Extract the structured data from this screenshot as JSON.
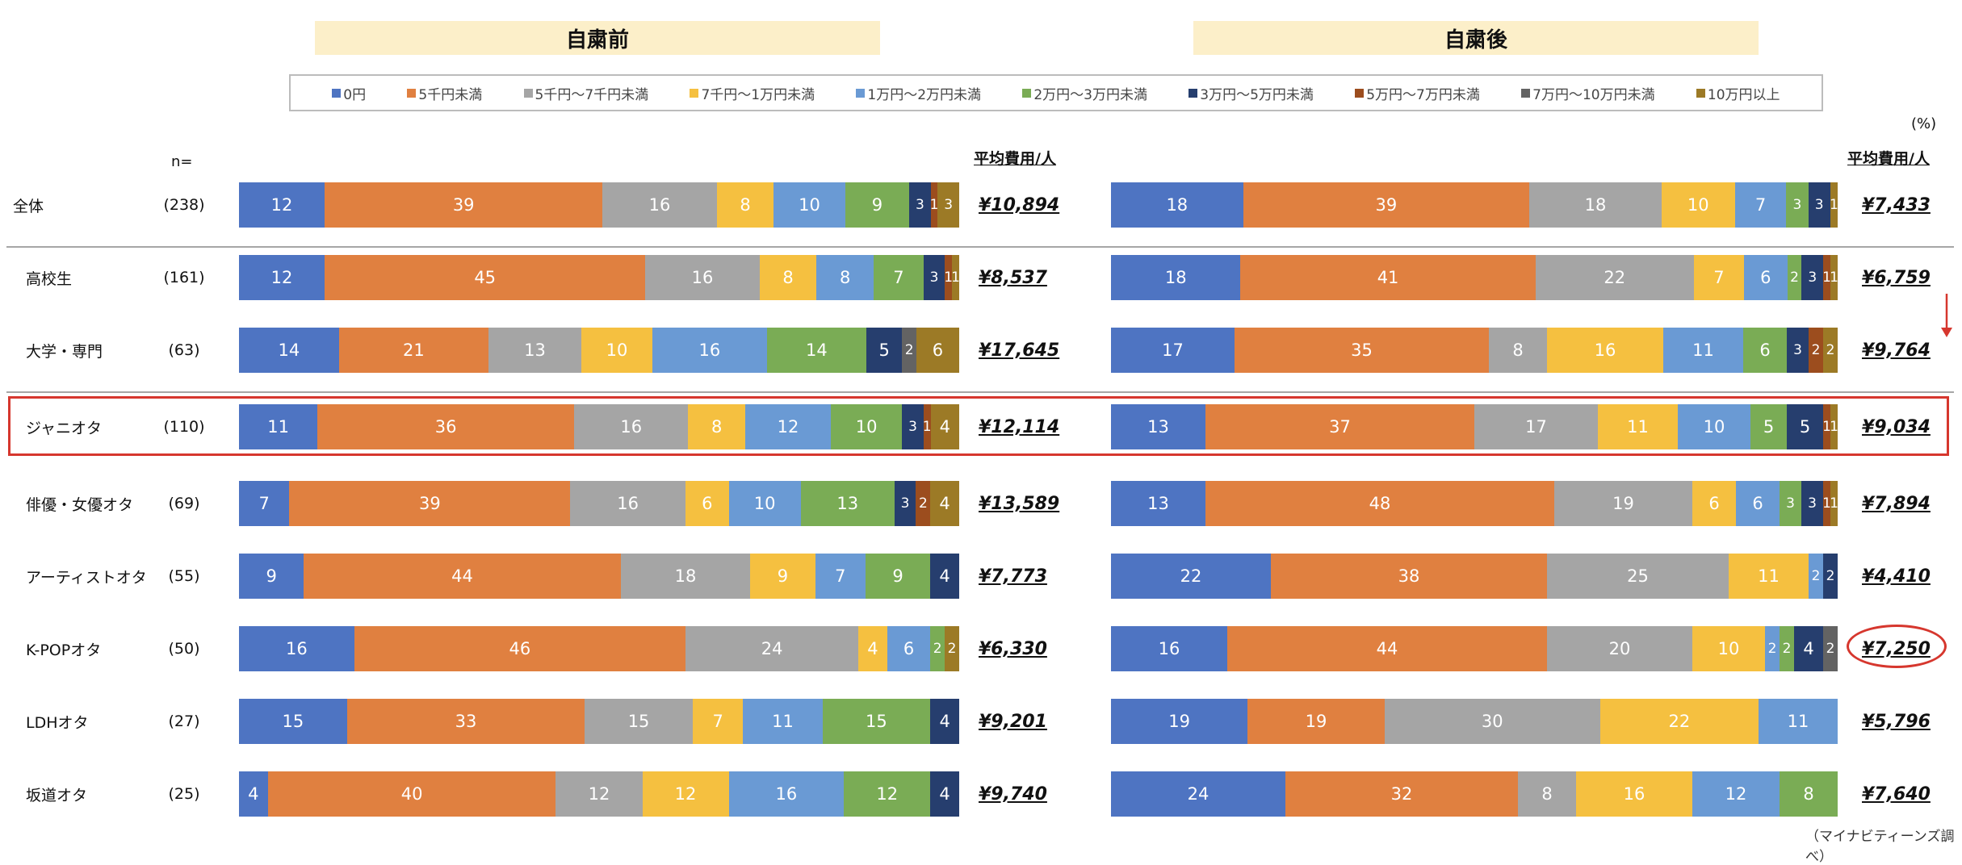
{
  "chart_data": {
    "type": "bar",
    "orientation": "horizontal",
    "stacked": true,
    "normalized": true,
    "panels": [
      {
        "name": "自粛前",
        "avg_header": "平均費用/人"
      },
      {
        "name": "自粛後",
        "avg_header": "平均費用/人"
      }
    ],
    "n_header": "n=",
    "unit": "(%)",
    "source": "（マイナビティーンズ調べ）",
    "legend": [
      "0円",
      "5千円未満",
      "5千円〜7千円未満",
      "7千円〜1万円未満",
      "1万円〜2万円未満",
      "2万円〜3万円未満",
      "3万円〜5万円未満",
      "5万円〜7万円未満",
      "7万円〜10万円未満",
      "10万円以上"
    ],
    "colors": [
      "#4e74c2",
      "#e08040",
      "#a5a5a5",
      "#f5c040",
      "#6a9ad4",
      "#7aac55",
      "#263e6e",
      "#9c4d1e",
      "#636363",
      "#9c7a26"
    ],
    "rows": [
      {
        "label": "全体",
        "n": "(238)",
        "before": [
          12,
          39,
          16,
          8,
          10,
          9,
          3,
          1,
          0,
          3
        ],
        "before_avg": "¥10,894",
        "after": [
          18,
          39,
          18,
          10,
          7,
          3,
          3,
          0,
          0,
          1
        ],
        "after_avg": "¥7,433"
      },
      {
        "label": "高校生",
        "n": "(161)",
        "before": [
          12,
          45,
          16,
          8,
          8,
          7,
          3,
          1,
          0,
          1
        ],
        "before_avg": "¥8,537",
        "after": [
          18,
          41,
          22,
          7,
          6,
          2,
          3,
          1,
          0,
          1
        ],
        "after_avg": "¥6,759"
      },
      {
        "label": "大学・専門",
        "n": "(63)",
        "before": [
          14,
          21,
          13,
          10,
          16,
          14,
          5,
          0,
          2,
          6
        ],
        "before_avg": "¥17,645",
        "after": [
          17,
          35,
          8,
          16,
          11,
          6,
          3,
          2,
          0,
          2
        ],
        "after_avg": "¥9,764"
      },
      {
        "label": "ジャニオタ",
        "n": "(110)",
        "before": [
          11,
          36,
          16,
          8,
          12,
          10,
          3,
          1,
          0,
          4
        ],
        "before_avg": "¥12,114",
        "after": [
          13,
          37,
          17,
          11,
          10,
          5,
          5,
          1,
          0,
          1
        ],
        "after_avg": "¥9,034"
      },
      {
        "label": "俳優・女優オタ",
        "n": "(69)",
        "before": [
          7,
          39,
          16,
          6,
          10,
          13,
          3,
          2,
          0,
          4
        ],
        "before_avg": "¥13,589",
        "after": [
          13,
          48,
          19,
          6,
          6,
          3,
          3,
          1,
          0,
          1
        ],
        "after_avg": "¥7,894"
      },
      {
        "label": "アーティストオタ",
        "n": "(55)",
        "before": [
          9,
          44,
          18,
          9,
          7,
          9,
          4,
          0,
          0,
          0
        ],
        "before_avg": "¥7,773",
        "after": [
          22,
          38,
          25,
          11,
          2,
          0,
          2,
          0,
          0,
          0
        ],
        "after_avg": "¥4,410"
      },
      {
        "label": "K-POPオタ",
        "n": "(50)",
        "before": [
          16,
          46,
          24,
          4,
          6,
          2,
          0,
          0,
          0,
          2
        ],
        "before_avg": "¥6,330",
        "after": [
          16,
          44,
          20,
          10,
          2,
          2,
          4,
          0,
          2,
          0
        ],
        "after_avg": "¥7,250"
      },
      {
        "label": "LDHオタ",
        "n": "(27)",
        "before": [
          15,
          33,
          15,
          7,
          11,
          15,
          4,
          0,
          0,
          0
        ],
        "before_avg": "¥9,201",
        "after": [
          19,
          19,
          30,
          22,
          11,
          0,
          0,
          0,
          0,
          0
        ],
        "after_avg": "¥5,796"
      },
      {
        "label": "坂道オタ",
        "n": "(25)",
        "before": [
          4,
          40,
          12,
          12,
          16,
          12,
          4,
          0,
          0,
          0
        ],
        "before_avg": "¥9,740",
        "after": [
          24,
          32,
          8,
          16,
          12,
          8,
          0,
          0,
          0,
          0
        ],
        "after_avg": "¥7,640"
      }
    ]
  }
}
